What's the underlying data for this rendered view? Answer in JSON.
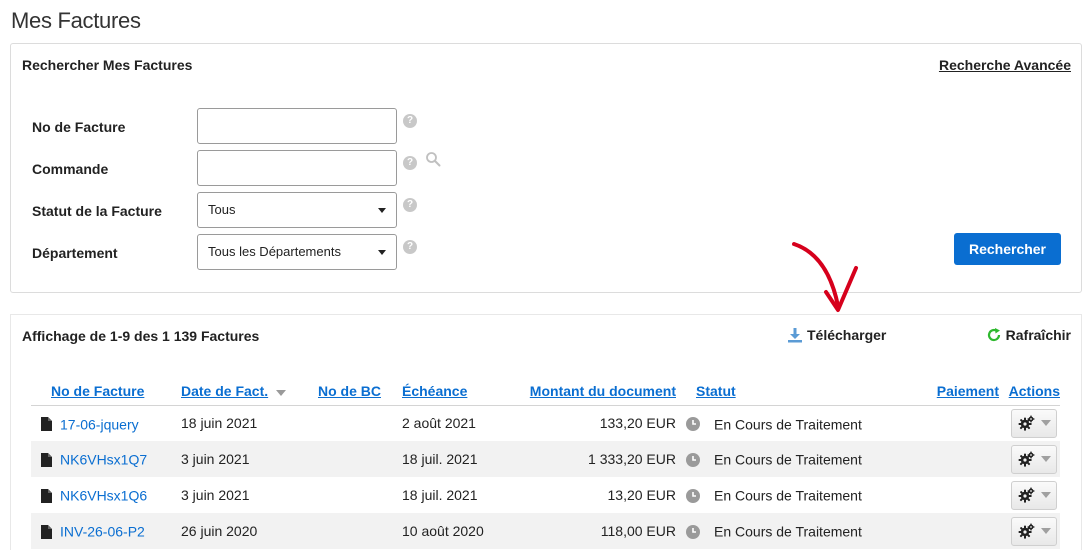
{
  "page": {
    "title": "Mes Factures"
  },
  "search": {
    "title": "Rechercher Mes Factures",
    "advanced_link": "Recherche Avancée",
    "fields": {
      "invoice_no": {
        "label": "No de Facture",
        "value": ""
      },
      "order": {
        "label": "Commande",
        "value": ""
      },
      "status": {
        "label": "Statut de la Facture",
        "value": "Tous"
      },
      "department": {
        "label": "Département",
        "value": "Tous les Départements"
      }
    },
    "help_glyph": "?",
    "button": "Rechercher"
  },
  "results": {
    "summary": "Affichage de 1-9 des 1 139 Factures",
    "download": "Télécharger",
    "refresh": "Rafraîchir",
    "columns": {
      "invoice_no": "No de Facture",
      "invoice_date": "Date de Fact.",
      "po_no": "No de BC",
      "due": "Échéance",
      "amount": "Montant du document",
      "status": "Statut",
      "payment": "Paiement",
      "actions": "Actions"
    },
    "rows": [
      {
        "invoice_no": "17-06-jquery",
        "invoice_date": "18 juin 2021",
        "po_no": "",
        "due": "2 août 2021",
        "amount": "133,20 EUR",
        "status": "En Cours de Traitement",
        "payment": ""
      },
      {
        "invoice_no": "NK6VHsx1Q7",
        "invoice_date": "3 juin 2021",
        "po_no": "",
        "due": "18 juil. 2021",
        "amount": "1 333,20 EUR",
        "status": "En Cours de Traitement",
        "payment": ""
      },
      {
        "invoice_no": "NK6VHsx1Q6",
        "invoice_date": "3 juin 2021",
        "po_no": "",
        "due": "18 juil. 2021",
        "amount": "13,20 EUR",
        "status": "En Cours de Traitement",
        "payment": ""
      },
      {
        "invoice_no": "INV-26-06-P2",
        "invoice_date": "26 juin 2020",
        "po_no": "",
        "due": "10 août 2020",
        "amount": "118,00 EUR",
        "status": "En Cours de Traitement",
        "payment": ""
      }
    ]
  },
  "icons": {
    "document": "document-icon",
    "clock": "clock-icon",
    "gear": "gear-icon",
    "download": "download-icon",
    "refresh": "refresh-icon",
    "search": "magnifier-icon",
    "annotation": "red-arrow-icon"
  },
  "colors": {
    "accent": "#0a6ed1",
    "annotation": "#d6001c",
    "refresh": "#2eb82e"
  }
}
